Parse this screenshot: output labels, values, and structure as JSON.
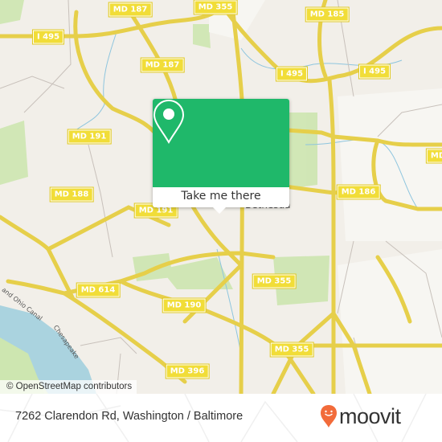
{
  "map": {
    "attribution": "© OpenStreetMap contributors",
    "road_labels": [
      {
        "text": "MD 187",
        "id": "md187-north"
      },
      {
        "text": "MD 355",
        "id": "md355-north"
      },
      {
        "text": "MD 185",
        "id": "md185"
      },
      {
        "text": "I 495",
        "id": "i495-west"
      },
      {
        "text": "MD 187",
        "id": "md187-mid"
      },
      {
        "text": "I 495",
        "id": "i495-center"
      },
      {
        "text": "I 495",
        "id": "i495-east"
      },
      {
        "text": "MD 191",
        "id": "md191-north"
      },
      {
        "text": "MD 188",
        "id": "md188"
      },
      {
        "text": "MD 191",
        "id": "md191-south"
      },
      {
        "text": "MD 186",
        "id": "md186"
      },
      {
        "text": "MD",
        "id": "md-east"
      },
      {
        "text": "MD 614",
        "id": "md614"
      },
      {
        "text": "MD 190",
        "id": "md190"
      },
      {
        "text": "MD 355",
        "id": "md355-mid"
      },
      {
        "text": "MD 355",
        "id": "md355-south"
      },
      {
        "text": "MD 396",
        "id": "md396"
      }
    ],
    "place_labels": {
      "canal": "and Ohio Canal",
      "chesapeake": "Chesapeake",
      "bethesda": "Bethesda"
    }
  },
  "popup": {
    "button_label": "Take me there",
    "accent_color": "#1fb86a"
  },
  "footer": {
    "address": "7262 Clarendon Rd, Washington / Baltimore",
    "brand": "moovit",
    "brand_color": "#f26b3a"
  }
}
